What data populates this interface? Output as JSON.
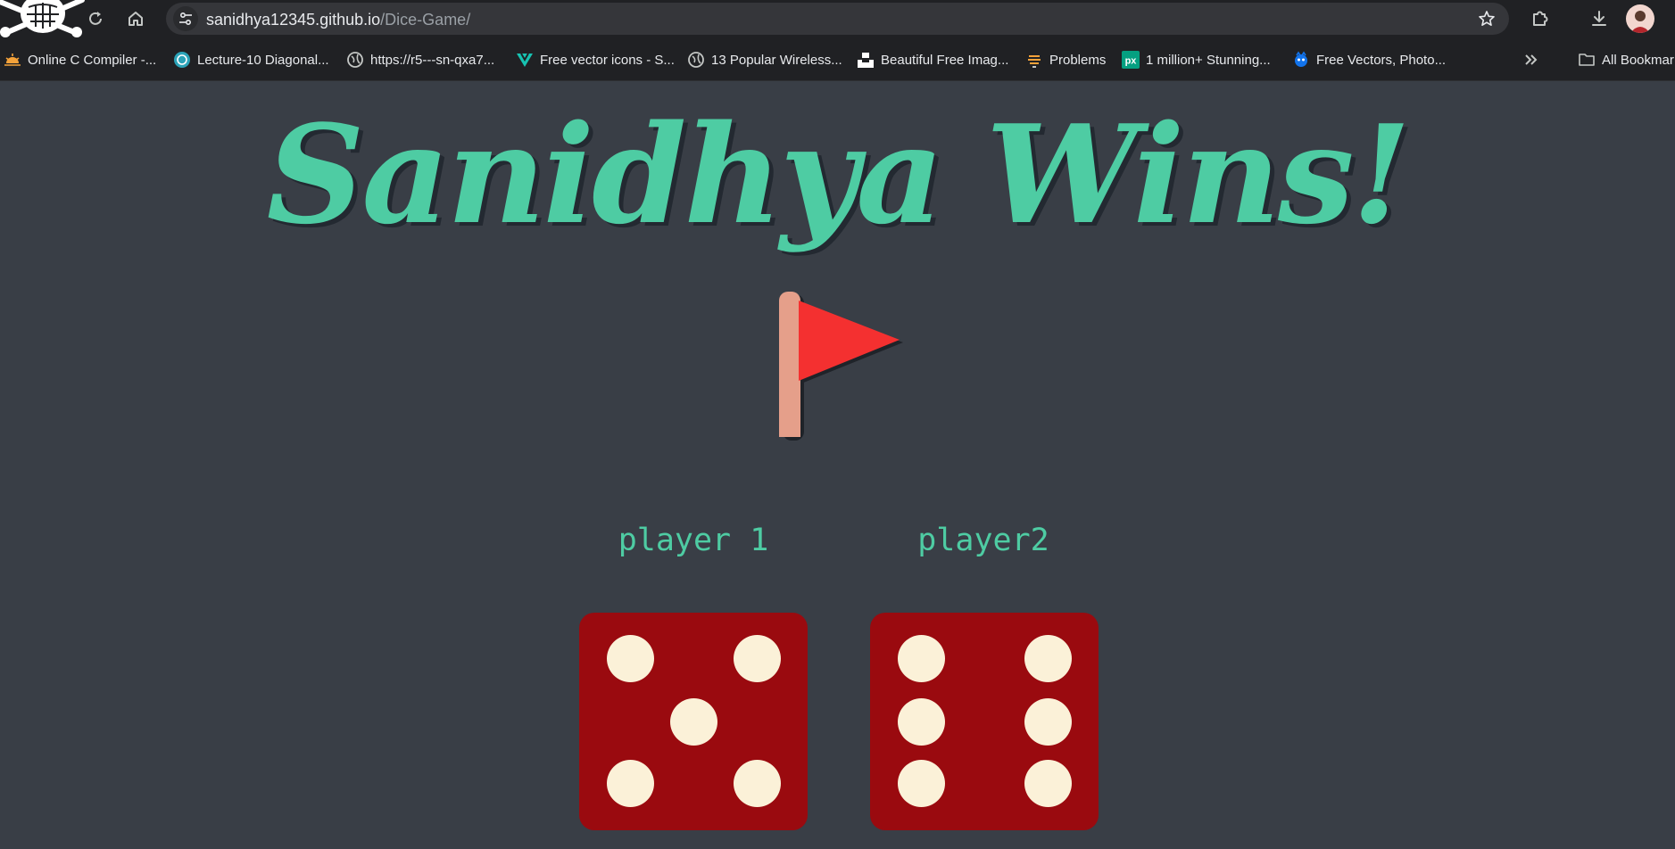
{
  "browser": {
    "url_host": "sanidhya12345.github.io",
    "url_path": "/Dice-Game/",
    "bookmarks": [
      {
        "label": "Online C Compiler -...",
        "icon": "sun-icon"
      },
      {
        "label": "Lecture-10 Diagonal...",
        "icon": "swirl-icon"
      },
      {
        "label": "https://r5---sn-qxa7...",
        "icon": "globe-icon"
      },
      {
        "label": "Free vector icons - S...",
        "icon": "vector-v-icon"
      },
      {
        "label": "13 Popular Wireless...",
        "icon": "globe-icon"
      },
      {
        "label": "Beautiful Free Imag...",
        "icon": "unsplash-icon"
      },
      {
        "label": "Problems",
        "icon": "stack-icon"
      },
      {
        "label": "1 million+ Stunning...",
        "icon": "px-icon"
      },
      {
        "label": "Free Vectors, Photo...",
        "icon": "freepik-icon"
      }
    ],
    "all_bookmarks_label": "All Bookmar"
  },
  "game": {
    "title": "Sanidhya Wins!",
    "player1_label": "player 1",
    "player2_label": "player2",
    "player1_dice_value": 5,
    "player2_dice_value": 6
  },
  "colors": {
    "accent": "#4ecca3",
    "background": "#393e46",
    "dice": "#9a0a0f",
    "pip": "#fbf1d8"
  }
}
